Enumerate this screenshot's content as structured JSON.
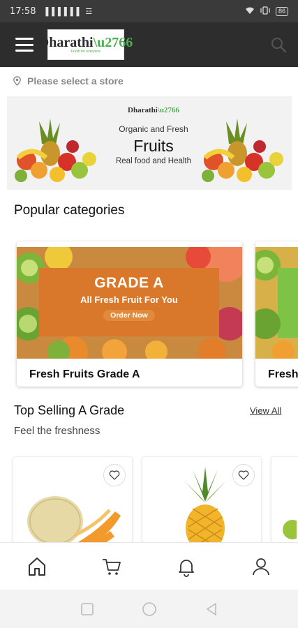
{
  "status": {
    "time": "17:58",
    "network": "▐▐▐ ▌▌▌ ☲",
    "battery": "86"
  },
  "header": {
    "logo_text": "Dharathi",
    "logo_sub": "Fresh for everyone"
  },
  "store": {
    "prompt": "Please select a store"
  },
  "banner": {
    "logo": "Dharathi",
    "tagline": "Organic and Fresh",
    "title": "Fruits",
    "subtitle": "Real food and Health"
  },
  "categories": {
    "heading": "Popular categories",
    "items": [
      {
        "label": "Fresh Fruits Grade A",
        "promo_title": "GRADE A",
        "promo_sub": "All Fresh Fruit For You",
        "promo_button": "Order Now"
      },
      {
        "label": "Fresh"
      }
    ]
  },
  "top_selling": {
    "heading": "Top Selling A Grade",
    "view_all": "View All",
    "subheading": "Feel the freshness"
  },
  "nav": {
    "items": [
      "home-icon",
      "cart-icon",
      "bell-icon",
      "user-icon"
    ]
  },
  "colors": {
    "appbar": "#2d2d2d",
    "promo": "#d9782a",
    "accent_green": "#4caf50"
  }
}
